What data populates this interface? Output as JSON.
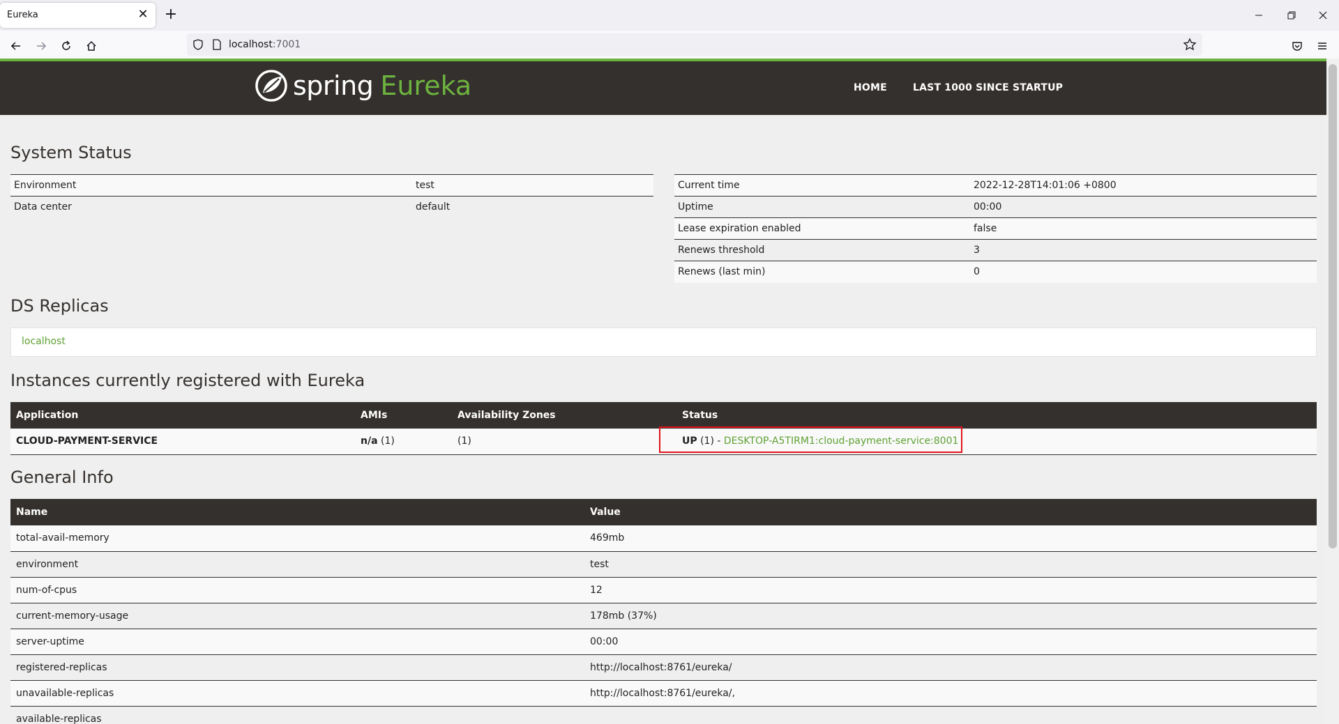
{
  "browser": {
    "tab_title": "Eureka",
    "url_host": "localhost",
    "url_port": ":7001"
  },
  "header": {
    "logo_word": "spring",
    "logo_product": "Eureka",
    "nav": [
      "HOME",
      "LAST 1000 SINCE STARTUP"
    ]
  },
  "system_status": {
    "title": "System Status",
    "left": [
      {
        "label": "Environment",
        "value": "test"
      },
      {
        "label": "Data center",
        "value": "default"
      }
    ],
    "right": [
      {
        "label": "Current time",
        "value": "2022-12-28T14:01:06 +0800"
      },
      {
        "label": "Uptime",
        "value": "00:00"
      },
      {
        "label": "Lease expiration enabled",
        "value": "false"
      },
      {
        "label": "Renews threshold",
        "value": "3"
      },
      {
        "label": "Renews (last min)",
        "value": "0"
      }
    ]
  },
  "ds_replicas": {
    "title": "DS Replicas",
    "items": [
      "localhost"
    ]
  },
  "instances": {
    "title": "Instances currently registered with Eureka",
    "columns": [
      "Application",
      "AMIs",
      "Availability Zones",
      "Status"
    ],
    "rows": [
      {
        "application": "CLOUD-PAYMENT-SERVICE",
        "amis_bold": "n/a",
        "amis_count": " (1)",
        "zones": "(1)",
        "status_bold": "UP",
        "status_count": " (1) - ",
        "status_link": "DESKTOP-A5TIRM1:cloud-payment-service:8001"
      }
    ]
  },
  "general_info": {
    "title": "General Info",
    "columns": [
      "Name",
      "Value"
    ],
    "rows": [
      {
        "name": "total-avail-memory",
        "value": "469mb"
      },
      {
        "name": "environment",
        "value": "test"
      },
      {
        "name": "num-of-cpus",
        "value": "12"
      },
      {
        "name": "current-memory-usage",
        "value": "178mb (37%)"
      },
      {
        "name": "server-uptime",
        "value": "00:00"
      },
      {
        "name": "registered-replicas",
        "value": "http://localhost:8761/eureka/"
      },
      {
        "name": "unavailable-replicas",
        "value": "http://localhost:8761/eureka/,"
      },
      {
        "name": "available-replicas",
        "value": ""
      }
    ]
  },
  "colors": {
    "spring_green": "#6db33f",
    "header_dark": "#34302d",
    "highlight_red": "#e0121a"
  }
}
